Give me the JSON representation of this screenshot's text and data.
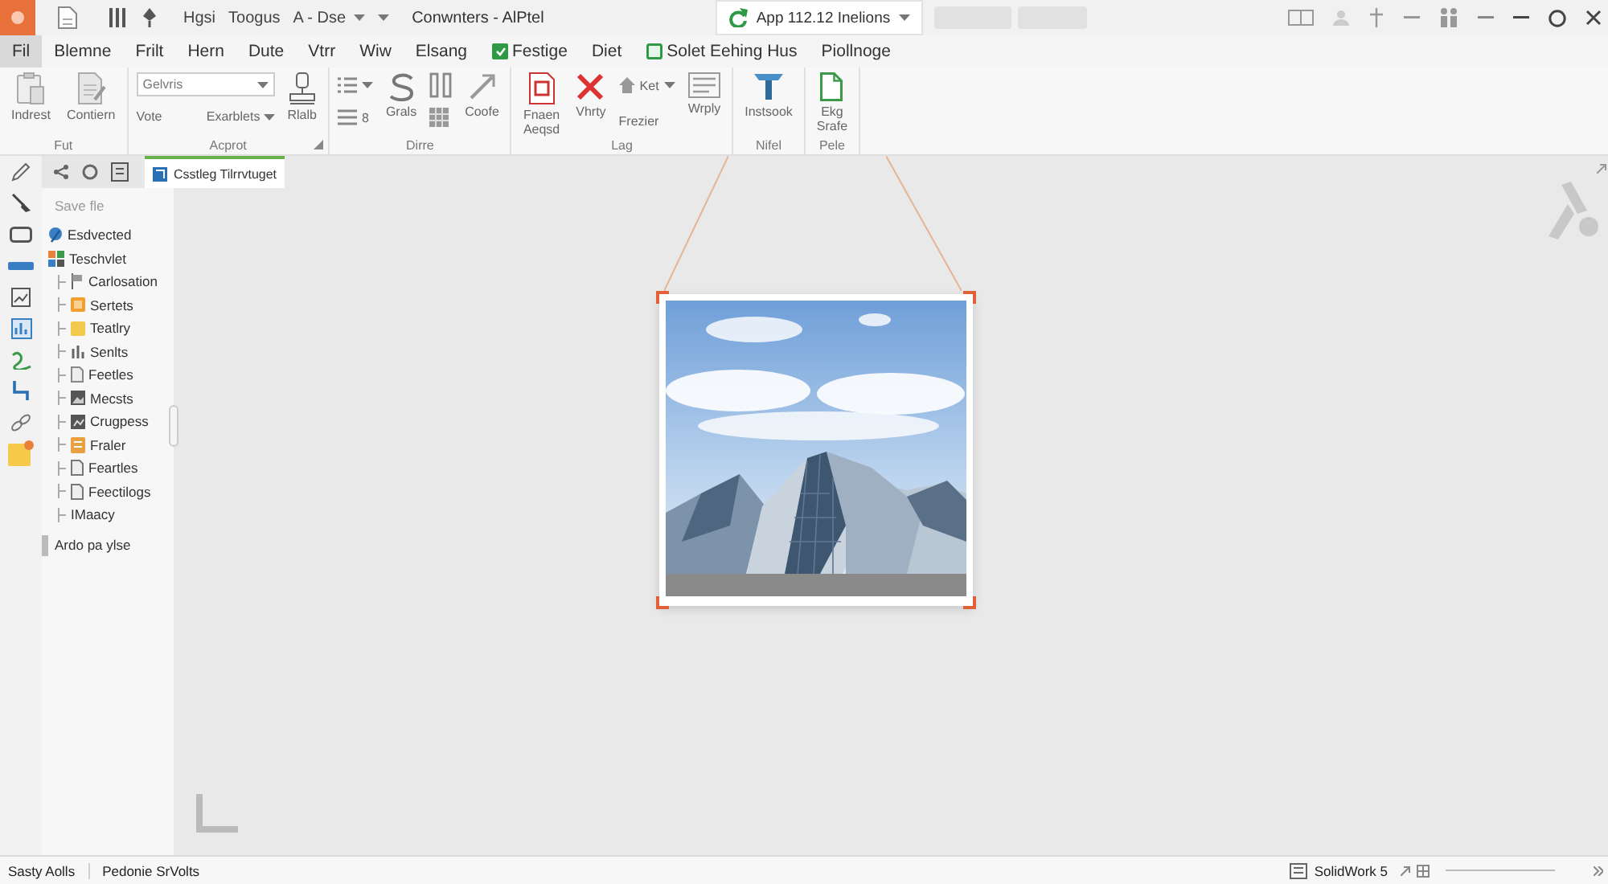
{
  "title_bar": {
    "items": [
      {
        "kind": "text",
        "label": "Hgsi"
      },
      {
        "kind": "text",
        "label": "Toogus"
      },
      {
        "kind": "dropdown",
        "label": "A - Dse"
      },
      {
        "kind": "caret"
      }
    ],
    "title": "Conwnters - AlPtel",
    "document_tab": {
      "label": "App 112.12 Inelions",
      "selected": true
    }
  },
  "menu": [
    {
      "label": "Fil",
      "selected": true,
      "kind": "plain"
    },
    {
      "label": "Blemne",
      "selected": false,
      "kind": "plain"
    },
    {
      "label": "Frilt",
      "selected": false,
      "kind": "plain"
    },
    {
      "label": "Hern",
      "selected": false,
      "kind": "plain"
    },
    {
      "label": "Dute",
      "selected": false,
      "kind": "plain"
    },
    {
      "label": "Vtrr",
      "selected": false,
      "kind": "plain"
    },
    {
      "label": "Wiw",
      "selected": false,
      "kind": "plain"
    },
    {
      "label": "Elsang",
      "selected": false,
      "kind": "plain"
    },
    {
      "label": "Festige",
      "selected": false,
      "kind": "icon"
    },
    {
      "label": "Diet",
      "selected": false,
      "kind": "plain"
    },
    {
      "label": "Solet Eehing Hus",
      "selected": false,
      "kind": "icon"
    },
    {
      "label": "Piollnoge",
      "selected": false,
      "kind": "plain"
    }
  ],
  "ribbon": {
    "groups": [
      {
        "label": "Fut",
        "launcher": false,
        "columns": [
          [
            {
              "kind": "large",
              "label": "Indrest"
            }
          ],
          [
            {
              "kind": "large",
              "label": "Contiern"
            }
          ]
        ]
      },
      {
        "label": "Acprot",
        "launcher": true,
        "columns": [
          [
            {
              "kind": "field",
              "value": "Gelvris"
            },
            {
              "kind": "split",
              "left": "Vote",
              "right": "Exarblets"
            }
          ],
          [
            {
              "kind": "large",
              "label": "Rlalb"
            }
          ]
        ]
      },
      {
        "label": "Dirre",
        "launcher": false,
        "columns": [
          [
            {
              "kind": "icon_caret"
            },
            {
              "kind": "small",
              "label": "8"
            }
          ],
          [
            {
              "kind": "large",
              "label": "Grals"
            }
          ],
          [
            {
              "kind": "icon"
            },
            {
              "kind": "icon"
            }
          ],
          [
            {
              "kind": "large",
              "label": "Coofe"
            }
          ]
        ]
      },
      {
        "label": "Lag",
        "launcher": false,
        "columns": [
          [
            {
              "kind": "large",
              "label": "Fnaen Aeqsd"
            }
          ],
          [
            {
              "kind": "large",
              "label": "Vhrty"
            }
          ],
          [
            {
              "kind": "small_caret",
              "label": "Ket"
            },
            {
              "kind": "text",
              "label": "Frezier"
            }
          ],
          [
            {
              "kind": "large",
              "label": "Wrply"
            }
          ]
        ]
      },
      {
        "label": "Nifel",
        "launcher": false,
        "columns": [
          [
            {
              "kind": "large",
              "label": "Instsook"
            }
          ]
        ]
      },
      {
        "label": "Pele",
        "launcher": false,
        "columns": [
          [
            {
              "kind": "large",
              "label": "Ekg Srafe"
            }
          ]
        ]
      }
    ]
  },
  "feature_panel": {
    "tab": {
      "label": "Csstleg Tilrrvtuget",
      "selected": true
    },
    "filter": {
      "placeholder": "Save fle"
    },
    "tree": [
      {
        "label": "Esdvected"
      },
      {
        "label": "Teschvlet",
        "children": [
          {
            "label": "Carlosation"
          },
          {
            "label": "Sertets"
          },
          {
            "label": "Teatlry"
          },
          {
            "label": "Senlts"
          },
          {
            "label": "Feetles"
          },
          {
            "label": "Mecsts"
          },
          {
            "label": "Crugpess"
          },
          {
            "label": "Fraler"
          },
          {
            "label": "Feartles"
          },
          {
            "label": "Feectilogs"
          },
          {
            "label": "IMaacy"
          }
        ]
      }
    ],
    "footer_item": "Ardo pa ylse"
  },
  "status_bar": {
    "items": [
      "Sasty Aolls",
      "Pedonie SrVolts"
    ],
    "product": "SolidWork 5"
  }
}
